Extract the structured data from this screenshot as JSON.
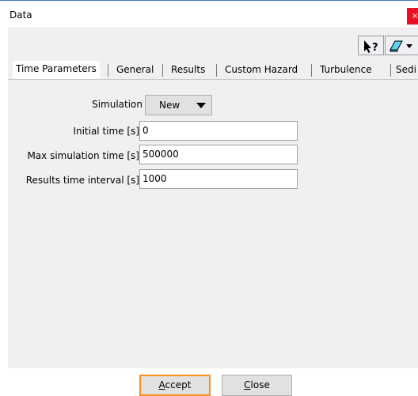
{
  "window": {
    "title": "Data",
    "close_glyph": "×"
  },
  "toolbar": {
    "buttons": [
      {
        "name": "context-help-button",
        "icon": "pointer-question-icon"
      },
      {
        "name": "erase-dropdown-button",
        "icon": "eraser-icon"
      }
    ]
  },
  "tabs": [
    {
      "label": "Time Parameters",
      "active": true
    },
    {
      "label": "General",
      "active": false
    },
    {
      "label": "Results",
      "active": false
    },
    {
      "label": "Custom Hazard",
      "active": false
    },
    {
      "label": "Turbulence",
      "active": false
    },
    {
      "label": "Sedi",
      "active": false
    }
  ],
  "form": {
    "simulation": {
      "label": "Simulation",
      "value": "New"
    },
    "initial_time": {
      "label": "Initial time [s]",
      "value": "0"
    },
    "max_simulation_time": {
      "label": "Max simulation time [s]",
      "value": "500000"
    },
    "results_time_interval": {
      "label": "Results time interval [s]",
      "value": "1000"
    }
  },
  "footer": {
    "accept": {
      "mnemonic": "A",
      "rest": "ccept"
    },
    "close": {
      "mnemonic": "C",
      "rest": "lose"
    }
  },
  "colors": {
    "close_button": "#e81123",
    "default_button_border": "#ff8c1a",
    "title_accent": "#3c78c8"
  }
}
